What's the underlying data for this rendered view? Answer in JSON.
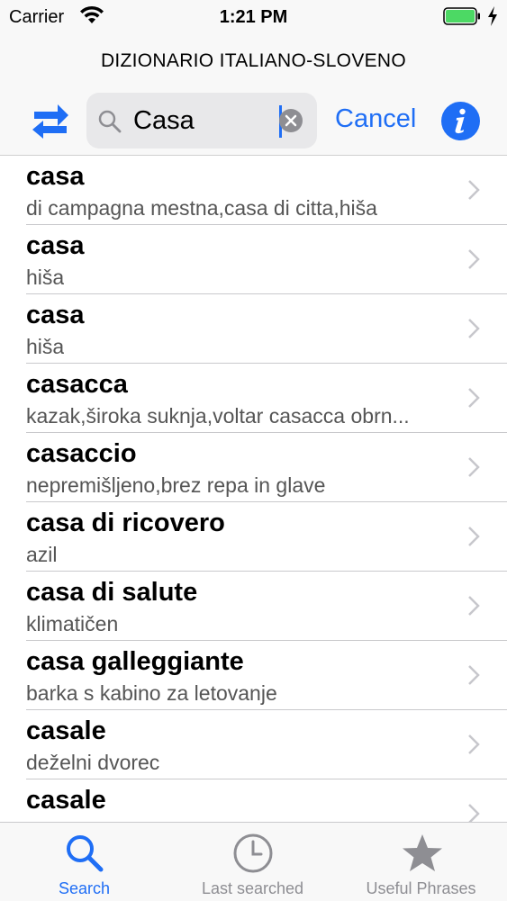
{
  "status_bar": {
    "carrier": "Carrier",
    "time": "1:21 PM"
  },
  "header": {
    "title": "DIZIONARIO ITALIANO-SLOVENO",
    "search_value": "Casa",
    "cancel_label": "Cancel"
  },
  "results": [
    {
      "word": "casa",
      "translation": "di campagna mestna,casa di citta,hiša"
    },
    {
      "word": "casa",
      "translation": "hiša"
    },
    {
      "word": "casa",
      "translation": "hiša"
    },
    {
      "word": "casacca",
      "translation": "kazak,široka suknja,voltar casacca obrn..."
    },
    {
      "word": "casaccio",
      "translation": "nepremišljeno,brez repa in glave"
    },
    {
      "word": "casa di ricovero",
      "translation": "azil"
    },
    {
      "word": "casa di salute",
      "translation": "klimatičen"
    },
    {
      "word": "casa galleggiante",
      "translation": "barka s kabino za letovanje"
    },
    {
      "word": "casale",
      "translation": "deželni dvorec"
    },
    {
      "word": "casale",
      "translation": ""
    }
  ],
  "tabs": [
    {
      "label": "Search",
      "icon": "search-icon",
      "active": true
    },
    {
      "label": "Last searched",
      "icon": "clock-icon",
      "active": false
    },
    {
      "label": "Useful Phrases",
      "icon": "star-icon",
      "active": false
    }
  ],
  "colors": {
    "accent": "#1f6ef5",
    "battery": "#4cd964",
    "inactive": "#8e8e93"
  }
}
